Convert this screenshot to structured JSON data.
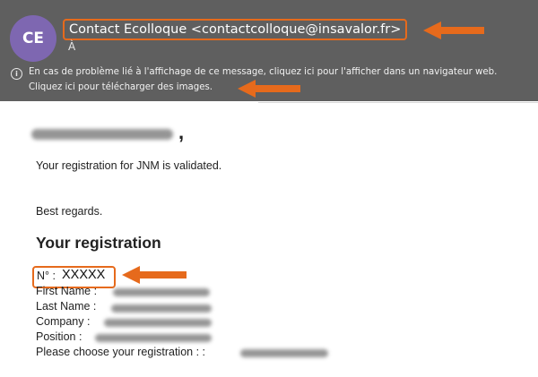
{
  "header": {
    "avatar_initials": "CE",
    "sender": "Contact Ecolloque <contactcolloque@insavalor.fr>",
    "recipient_label": "À",
    "info_line_1": "En cas de problème lié à l'affichage de ce message, cliquez ici pour l'afficher dans un navigateur web.",
    "info_line_2": "Cliquez ici pour télécharger des images."
  },
  "message": {
    "comma": ",",
    "validated_text": "Your registration for JNM is validated.",
    "regards": "Best regards.",
    "section_title": "Your registration",
    "number_label": "N° :",
    "number_value": "XXXXX",
    "fields": {
      "first_name": "First Name :",
      "last_name": "Last Name :",
      "company": "Company :",
      "position": "Position :",
      "registration_choice": "Please choose your registration : :"
    }
  },
  "colors": {
    "header_bg": "#5f5f5f",
    "avatar_bg": "#7e67b1",
    "highlight": "#e66a1c"
  },
  "icons": [
    "info-icon",
    "arrow-left-icon"
  ]
}
